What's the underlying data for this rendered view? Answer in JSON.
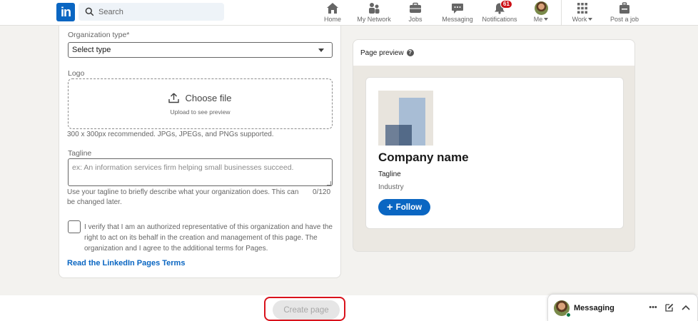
{
  "nav": {
    "search_placeholder": "Search",
    "logo_text": "in",
    "items": [
      {
        "label": "Home"
      },
      {
        "label": "My Network"
      },
      {
        "label": "Jobs"
      },
      {
        "label": "Messaging"
      },
      {
        "label": "Notifications",
        "badge": "61"
      },
      {
        "label": "Me"
      },
      {
        "label": "Work"
      },
      {
        "label": "Post a job"
      }
    ]
  },
  "form": {
    "org_type_label": "Organization type*",
    "org_type_value": "Select type",
    "logo_label": "Logo",
    "choose_file": "Choose file",
    "upload_hint": "Upload to see preview",
    "logo_hint": "300 x 300px recommended. JPGs, JPEGs, and PNGs supported.",
    "tagline_label": "Tagline",
    "tagline_placeholder": "ex: An information services firm helping small businesses succeed.",
    "tagline_hint": "Use your tagline to briefly describe what your organization does. This can be changed later.",
    "tagline_count": "0/120",
    "verify_text": "I verify that I am an authorized representative of this organization and have the right to act on its behalf in the creation and management of this page. The organization and I agree to the additional terms for Pages.",
    "terms_link": "Read the LinkedIn Pages Terms"
  },
  "preview": {
    "heading": "Page preview",
    "company_name": "Company name",
    "tagline": "Tagline",
    "industry": "Industry",
    "follow_label": "Follow"
  },
  "footer": {
    "create_label": "Create page"
  },
  "messaging_bar": {
    "label": "Messaging"
  },
  "colors": {
    "brand": "#0a66c2",
    "highlight": "#d9121b",
    "badge": "#cc1016"
  }
}
